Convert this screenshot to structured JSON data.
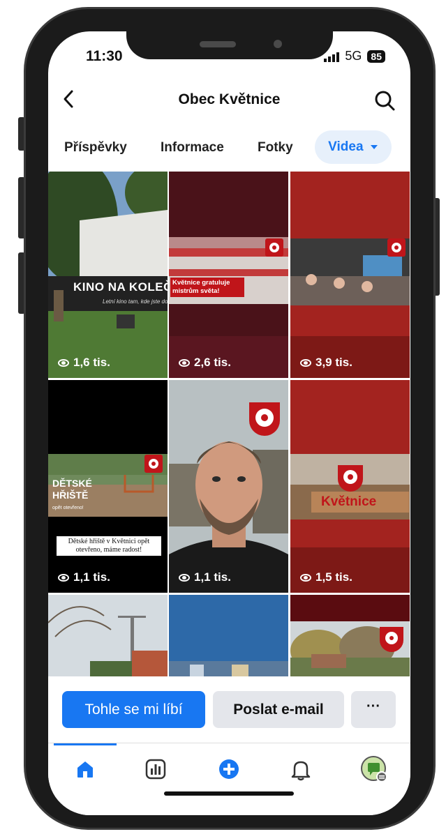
{
  "status_bar": {
    "time": "11:30",
    "network": "5G",
    "battery": "85"
  },
  "header": {
    "title": "Obec Květnice",
    "back_icon": "back-chevron-icon",
    "search_icon": "search-icon"
  },
  "tabs": [
    {
      "label": "Příspěvky"
    },
    {
      "label": "Informace"
    },
    {
      "label": "Fotky"
    },
    {
      "label": "Videa",
      "active": true
    }
  ],
  "videos": [
    {
      "views": "1,6 tis.",
      "overlay": "KINO NA KOLEČ",
      "sub": "Letní kino tam, kde jste doma"
    },
    {
      "views": "2,6 tis.",
      "overlay": "Květnice gratuluje mistrům světa!"
    },
    {
      "views": "3,9 tis."
    },
    {
      "views": "1,1 tis.",
      "overlay": "DĚTSKÉ HŘIŠTĚ",
      "sub": "opět otevřeno!",
      "caption": "Dětské hřiště v Květnici opět otevřeno, máme radost!"
    },
    {
      "views": "1,1 tis."
    },
    {
      "views": "1,5 tis.",
      "overlay": "Květnice"
    },
    {
      "views": ""
    },
    {
      "views": ""
    },
    {
      "views": ""
    }
  ],
  "actions": {
    "like": "Tohle se mi líbí",
    "email": "Poslat e-mail",
    "more": "···"
  },
  "navbar": {
    "items": [
      "home-icon",
      "dashboard-icon",
      "create-icon",
      "notifications-icon",
      "profile-icon"
    ]
  },
  "colors": {
    "accent": "#1877f2",
    "brand_red": "#c0151a"
  }
}
